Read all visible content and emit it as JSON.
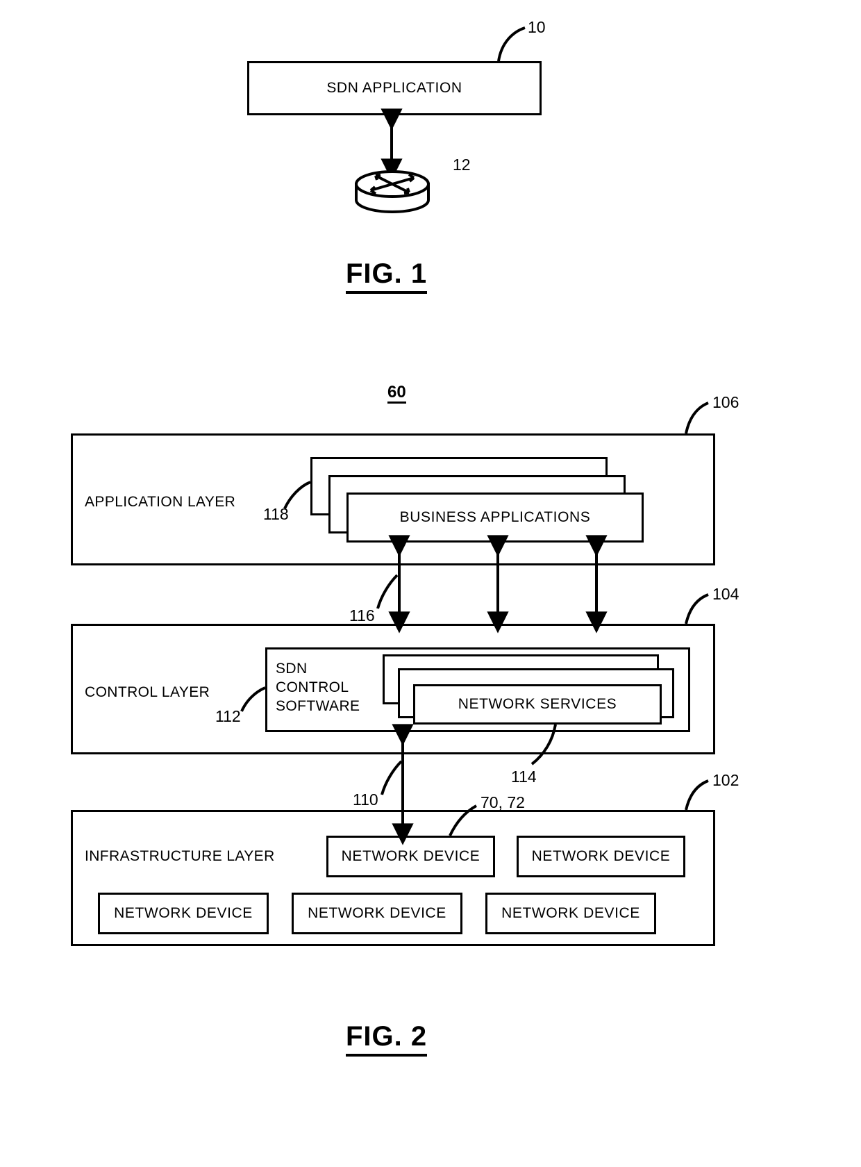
{
  "figure1": {
    "caption": "FIG. 1",
    "sdn_application": {
      "label": "SDN APPLICATION",
      "callout": "10"
    },
    "router": {
      "icon": "router-icon",
      "callout": "12"
    }
  },
  "figure2": {
    "caption": "FIG. 2",
    "diagram_ref": "60",
    "layers": [
      {
        "name": "APPLICATION LAYER",
        "callout": "106",
        "inner_stack": {
          "label": "BUSINESS APPLICATIONS",
          "callout": "118",
          "card_count": 3
        }
      },
      {
        "name": "CONTROL LAYER",
        "callout": "104",
        "control_software": {
          "label": "SDN\nCONTROL\nSOFTWARE",
          "callout": "112"
        },
        "inner_stack": {
          "label": "NETWORK SERVICES",
          "callout": "114",
          "card_count": 3
        }
      },
      {
        "name": "INFRASTRUCTURE LAYER",
        "callout": "102",
        "devices_row_top": [
          {
            "label": "NETWORK DEVICE",
            "callout": "70, 72"
          },
          {
            "label": "NETWORK DEVICE",
            "callout": ""
          }
        ],
        "devices_row_bottom": [
          {
            "label": "NETWORK DEVICE",
            "callout": ""
          },
          {
            "label": "NETWORK DEVICE",
            "callout": ""
          },
          {
            "label": "NETWORK DEVICE",
            "callout": ""
          }
        ]
      }
    ],
    "interface_callouts": {
      "northbound": "116",
      "southbound": "110"
    }
  },
  "colors": {
    "stroke": "#000000",
    "background": "#ffffff"
  }
}
